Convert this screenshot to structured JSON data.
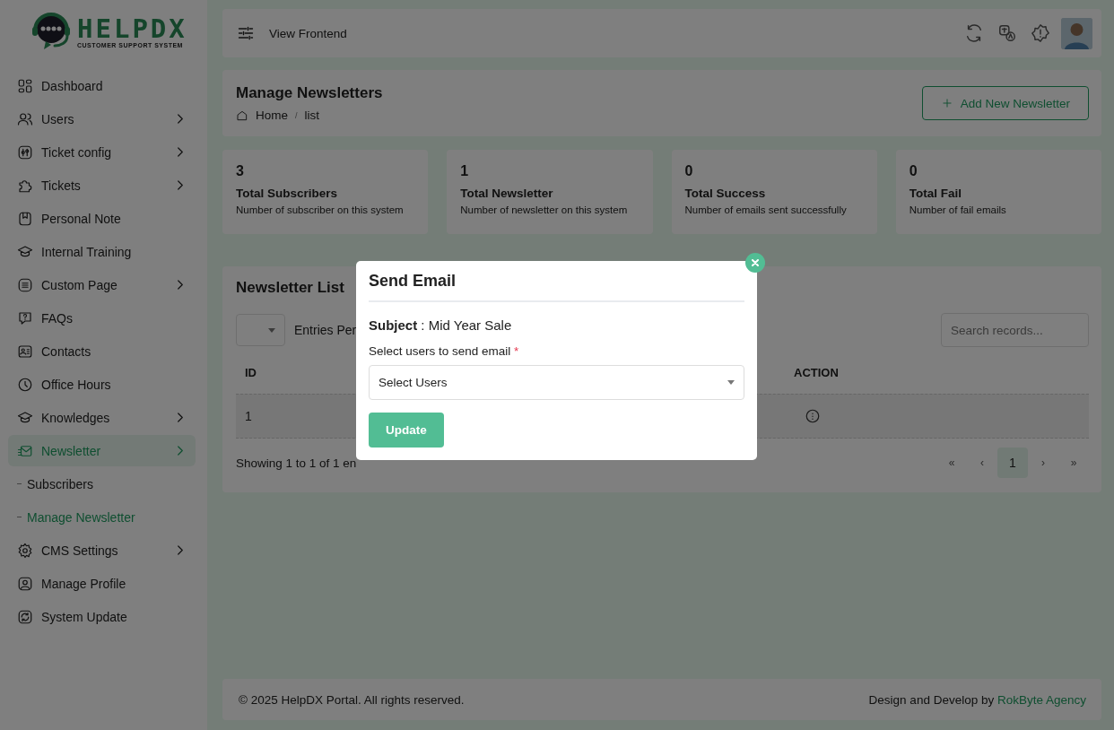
{
  "logo": {
    "name": "HELPDX",
    "tagline": "CUSTOMER SUPPORT SYSTEM"
  },
  "sidebar": {
    "items": [
      {
        "label": "Dashboard",
        "selected": false,
        "expandable": false
      },
      {
        "label": "Users",
        "selected": false,
        "expandable": true
      },
      {
        "label": "Ticket config",
        "selected": false,
        "expandable": true
      },
      {
        "label": "Tickets",
        "selected": false,
        "expandable": true
      },
      {
        "label": "Personal Note",
        "selected": false,
        "expandable": false
      },
      {
        "label": "Internal Training",
        "selected": false,
        "expandable": false
      },
      {
        "label": "Custom Page",
        "selected": false,
        "expandable": true
      },
      {
        "label": "FAQs",
        "selected": false,
        "expandable": false
      },
      {
        "label": "Contacts",
        "selected": false,
        "expandable": false
      },
      {
        "label": "Office Hours",
        "selected": false,
        "expandable": false
      },
      {
        "label": "Knowledges",
        "selected": false,
        "expandable": true
      },
      {
        "label": "Newsletter",
        "selected": true,
        "expandable": true,
        "children": [
          {
            "label": "Subscribers",
            "selected": false
          },
          {
            "label": "Manage Newsletter",
            "selected": true
          }
        ]
      },
      {
        "label": "CMS Settings",
        "selected": false,
        "expandable": true
      },
      {
        "label": "Manage Profile",
        "selected": false,
        "expandable": false
      },
      {
        "label": "System Update",
        "selected": false,
        "expandable": false
      }
    ]
  },
  "topbar": {
    "link": "View Frontend"
  },
  "page_header": {
    "title": "Manage Newsletters",
    "breadcrumb": [
      "Home",
      "/",
      "list"
    ],
    "add_button": "Add New Newsletter"
  },
  "stats": [
    {
      "value": "3",
      "title": "Total Subscribers",
      "description": "Number of subscriber on this system"
    },
    {
      "value": "1",
      "title": "Total Newsletter",
      "description": "Number of newsletter on this system"
    },
    {
      "value": "0",
      "title": "Total Success",
      "description": "Number of emails sent successfully"
    },
    {
      "value": "0",
      "title": "Total Fail",
      "description": "Number of fail emails"
    }
  ],
  "newsletter_list": {
    "title": "Newsletter List",
    "entries_label": "Entries Per",
    "search": {
      "placeholder": "Search records..."
    },
    "columns": [
      "ID",
      "ACTION"
    ],
    "rows": [
      {
        "id": "1"
      }
    ],
    "info": "Showing 1 to 1 of 1 en",
    "pagination": [
      {
        "label": "«",
        "selected": false
      },
      {
        "label": "‹",
        "selected": false
      },
      {
        "label": "1",
        "selected": true
      },
      {
        "label": "›",
        "selected": false
      },
      {
        "label": "»",
        "selected": false
      }
    ]
  },
  "footer": {
    "copyright": "© 2025 HelpDX Portal. All rights reserved.",
    "credit": "Design and Develop by",
    "credit_link": "RokByte Agency"
  },
  "modal": {
    "title": "Send Email",
    "subject": "**Subject** : Mid Year Sale",
    "field_label": "Select users to send email",
    "required_mark": "*",
    "select": {
      "placeholder": "Select Users"
    },
    "button": "Update"
  }
}
